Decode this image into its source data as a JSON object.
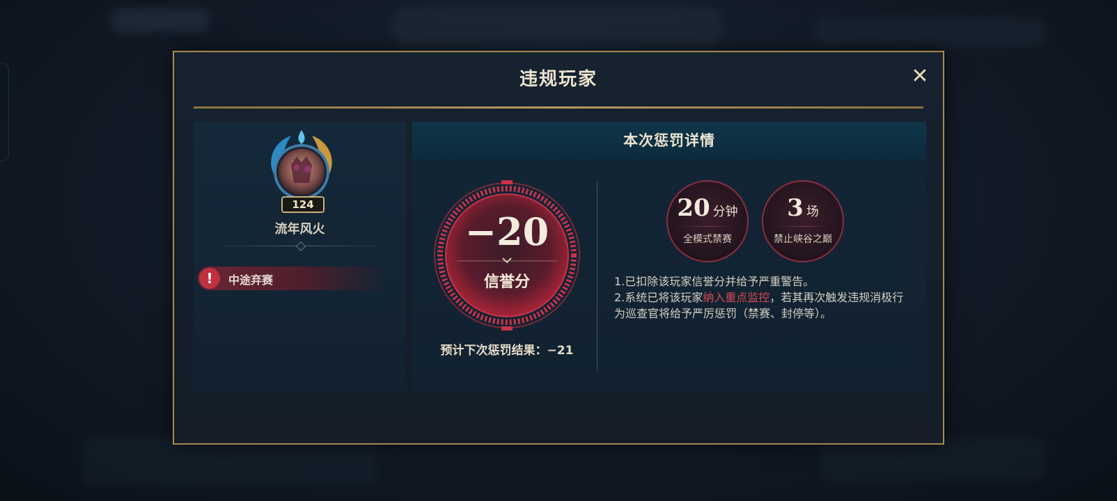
{
  "modal": {
    "title": "违规玩家",
    "close_symbol": "✕"
  },
  "player": {
    "level": "124",
    "name": "流年风火",
    "violation": "中途弃赛",
    "violation_icon": "!"
  },
  "penalty": {
    "header": "本次惩罚详情",
    "score_value": "−20",
    "score_label": "信誉分",
    "next_penalty": "预计下次惩罚结果：−21",
    "bans": [
      {
        "value": "20",
        "unit": "分钟",
        "desc": "全模式禁赛"
      },
      {
        "value": "3",
        "unit": "场",
        "desc": "禁止峡谷之巅"
      }
    ],
    "note1": "1.已扣除该玩家信誉分并给予严重警告。",
    "note2_prefix": "2.系统已将该玩家",
    "note2_highlight": "纳入重点监控",
    "note2_suffix": "，若其再次触发违规消极行为巡查官将给予严厉惩罚（禁赛、封停等）。"
  },
  "colors": {
    "gold_border": "#a8894e",
    "accent_red": "#c0313e",
    "highlight_red": "#d8484e"
  }
}
